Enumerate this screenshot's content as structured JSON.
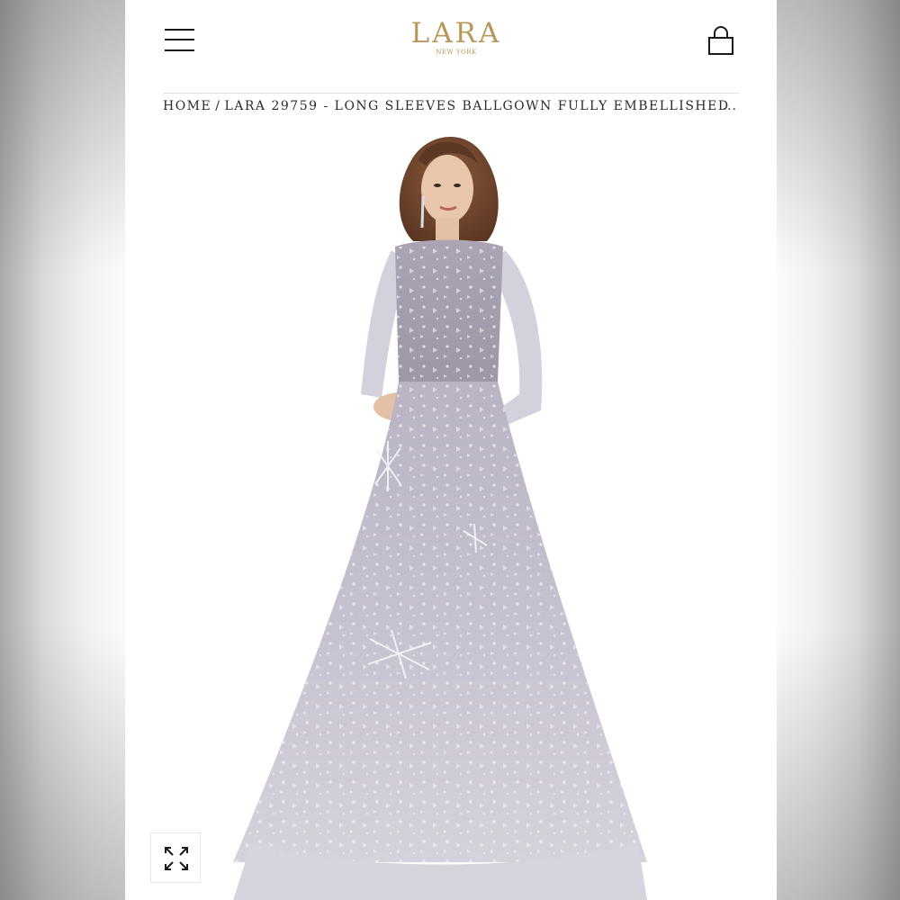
{
  "brand": {
    "name": "LARA",
    "subtitle": "NEW YORK",
    "accent_color": "#b9975b"
  },
  "header": {
    "menu_icon": "hamburger-menu-icon",
    "cart_icon": "shopping-bag-icon"
  },
  "breadcrumb": {
    "home": "HOME",
    "separator": "/",
    "current": "LARA 29759 - LONG SLEEVES BALLGOWN FULLY EMBELLISHED",
    "overflow": "..."
  },
  "product_image": {
    "description_icon": "product-photo"
  },
  "controls": {
    "fullscreen_icon": "expand-arrows-icon"
  }
}
